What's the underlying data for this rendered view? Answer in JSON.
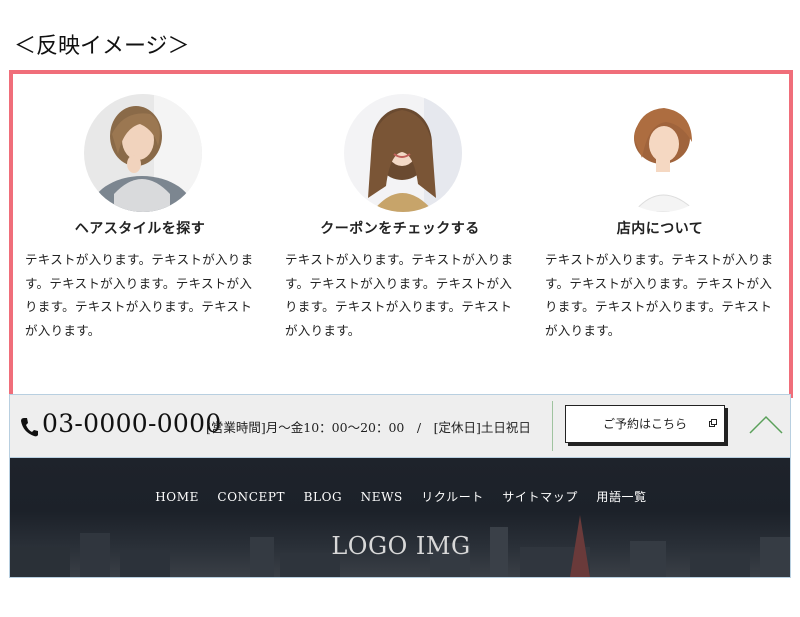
{
  "caption": "＜反映イメージ＞",
  "features": [
    {
      "title": "ヘアスタイルを探す",
      "text": "テキストが入ります。テキストが入ります。テキストが入ります。テキストが入ります。テキストが入ります。テキストが入ります。",
      "image": "woman-curly-hair-photo"
    },
    {
      "title": "クーポンをチェックする",
      "text": "テキストが入ります。テキストが入ります。テキストが入ります。テキストが入ります。テキストが入ります。テキストが入ります。",
      "image": "woman-long-wavy-hair-photo"
    },
    {
      "title": "店内について",
      "text": "テキストが入ります。テキストが入ります。テキストが入ります。テキストが入ります。テキストが入ります。テキストが入ります。",
      "image": "woman-bob-hair-photo"
    }
  ],
  "contact": {
    "phone": "03-0000-0000",
    "hours": "[営業時間]月～金10：00～20：00　/　[定休日]土日祝日",
    "reserve_label": "ご予約はこちら",
    "phone_icon": "phone-icon",
    "up_icon": "chevron-up-icon",
    "accent": "#5aa05a"
  },
  "footer": {
    "nav": [
      "HOME",
      "CONCEPT",
      "BLOG",
      "NEWS",
      "リクルート",
      "サイトマップ",
      "用語一覧"
    ],
    "logo": "LOGO IMG"
  },
  "colors": {
    "frame_border": "#f06e7a",
    "bar_bg": "#eeeeee",
    "footer_bg": "#1e232b"
  }
}
